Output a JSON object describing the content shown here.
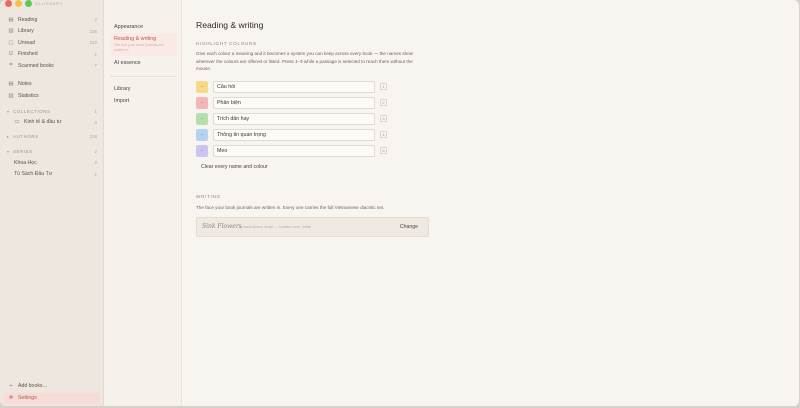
{
  "app": {
    "title": "GLOSSARY"
  },
  "sidebar": {
    "library": [
      {
        "icon": "book-open-icon",
        "glyph": "▤",
        "label": "Reading",
        "count": "2"
      },
      {
        "icon": "library-icon",
        "glyph": "▥",
        "label": "Library",
        "count": "226"
      },
      {
        "icon": "unread-book-icon",
        "glyph": "▢",
        "label": "Unread",
        "count": "222"
      },
      {
        "icon": "check-icon",
        "glyph": "☑",
        "label": "Finished",
        "count": "1"
      },
      {
        "icon": "scan-icon",
        "glyph": "⌗",
        "label": "Scanned books",
        "count": "7"
      }
    ],
    "tools": [
      {
        "icon": "notes-icon",
        "glyph": "▤",
        "label": "Notes"
      },
      {
        "icon": "statistics-icon",
        "glyph": "▥",
        "label": "Statistics"
      }
    ],
    "collections": {
      "label": "Collections",
      "count": "1",
      "items": [
        {
          "label": "Kinh tế & đầu tư",
          "count": "0"
        }
      ]
    },
    "authors": {
      "label": "Authors",
      "count": "218"
    },
    "series": {
      "label": "Series",
      "count": "2",
      "items": [
        {
          "label": "Khoa Học",
          "count": "2"
        },
        {
          "label": "Tủ Sách Đầu Tư",
          "count": "1"
        }
      ]
    },
    "bottom": {
      "add_books": "Add books…",
      "settings": "Settings"
    }
  },
  "settings_nav": {
    "appearance": "Appearance",
    "reading_writing": "Reading & writing",
    "reading_writing_sub": "The font your book journals are written in.",
    "ai_essence": "AI essence",
    "library": "Library",
    "import": "Import"
  },
  "content": {
    "title": "Reading & writing",
    "highlight_label": "Highlight colours",
    "highlight_desc_1": "Give each colour a meaning and it becomes a system you can keep across every book — the names show wherever the colours are offered or listed. Press ",
    "highlight_desc_keys": "1–5",
    "highlight_desc_2": " while a passage is selected to reach them without the mouse.",
    "highlights": [
      {
        "color": "#f7d98a",
        "name": "Câu hỏi",
        "key": "1"
      },
      {
        "color": "#f3b7b9",
        "name": "Phản biện",
        "key": "2"
      },
      {
        "color": "#b6dfb0",
        "name": "Trích dẫn hay",
        "key": "3"
      },
      {
        "color": "#b4d3ee",
        "name": "Thông tin quan trọng",
        "key": "4"
      },
      {
        "color": "#cfc3ef",
        "name": "Meo",
        "key": "5"
      }
    ],
    "clear_label": "Clear every name and colour",
    "writing_label": "Writing",
    "writing_desc": "The face your book journals are written in. Every one carries the full Vietnamese diacritic set.",
    "font_name": "Sink Flowers",
    "font_hint": "a hand-drawn script — loaded once, inline",
    "change_label": "Change"
  },
  "colors": {
    "accent": "#c2574a",
    "active_bg": "#f6dcd7"
  }
}
